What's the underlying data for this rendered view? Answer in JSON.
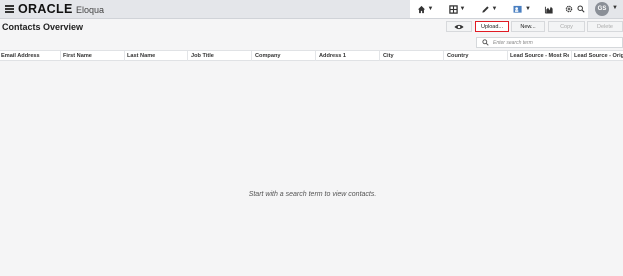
{
  "header": {
    "logo_text": "ORACLE",
    "logo_sub": "Eloqua",
    "nav_icons": [
      "home-icon",
      "grid-icon",
      "pencil-icon",
      "contacts-icon",
      "chart-icon",
      "gear-icon",
      "search-icon"
    ],
    "avatar_initials": "GS"
  },
  "toolbar": {
    "title": "Contacts Overview",
    "upload_label": "Upload...",
    "new_label": "New...",
    "copy_label": "Copy",
    "delete_label": "Delete"
  },
  "search": {
    "placeholder": "Enter search term"
  },
  "table": {
    "columns": [
      "Email Address",
      "First Name",
      "Last Name",
      "Job Title",
      "Company",
      "Address 1",
      "City",
      "Country",
      "Lead Source - Most Re",
      "Lead Source - Origi"
    ]
  },
  "empty_state": {
    "message": "Start with a search term to view contacts."
  },
  "colors": {
    "highlight": "#e01b24",
    "header_bg": "#e4e6ea"
  }
}
